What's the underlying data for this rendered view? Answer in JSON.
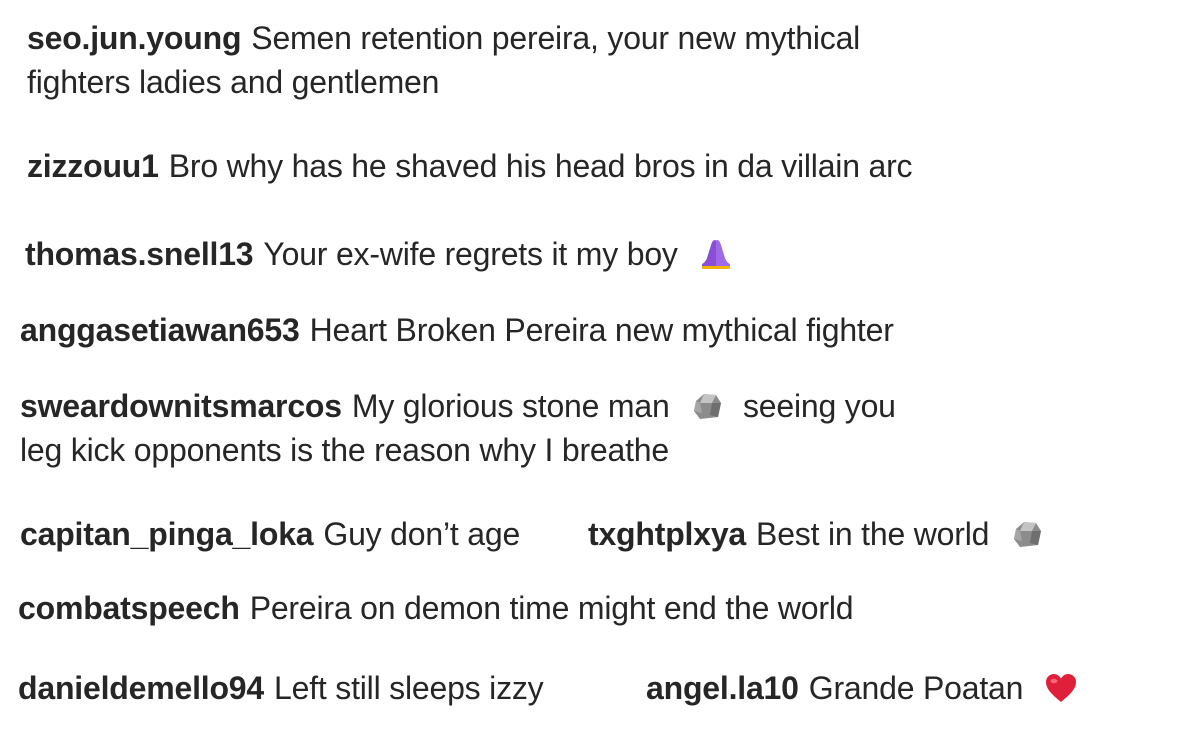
{
  "comments": [
    {
      "username": "seo.jun.young",
      "text_line1": "Semen retention pereira, your new mythical",
      "text_line2": "fighters ladies and gentlemen"
    },
    {
      "username": "zizzouu1",
      "text": "Bro why has he shaved his head bros in da villain arc"
    },
    {
      "username": "thomas.snell13",
      "text": "Your ex-wife regrets it my boy",
      "emoji": "folded-hands-icon"
    },
    {
      "username": "anggasetiawan653",
      "text": "Heart Broken Pereira new mythical fighter"
    },
    {
      "username": "sweardownitsmarcos",
      "text_before_emoji": "My glorious stone man",
      "emoji": "rock-icon",
      "text_after_emoji": "seeing you",
      "text_line2": "leg kick opponents is the reason why I breathe"
    },
    {
      "username": "capitan_pinga_loka",
      "text": "Guy don’t age"
    },
    {
      "username": "txghtplxya",
      "text": "Best in the world",
      "emoji": "rock-icon"
    },
    {
      "username": "combatspeech",
      "text": "Pereira on demon time might end the world"
    },
    {
      "username": "danieldemello94",
      "text": "Left still sleeps izzy"
    },
    {
      "username": "angel.la10",
      "text": "Grande Poatan",
      "emoji": "red-heart-icon"
    }
  ],
  "colors": {
    "text": "#262626",
    "background": "#ffffff",
    "emoji_purple": "#8a4fd6",
    "emoji_red": "#e0203a",
    "emoji_stone": "#9a9a9a"
  }
}
